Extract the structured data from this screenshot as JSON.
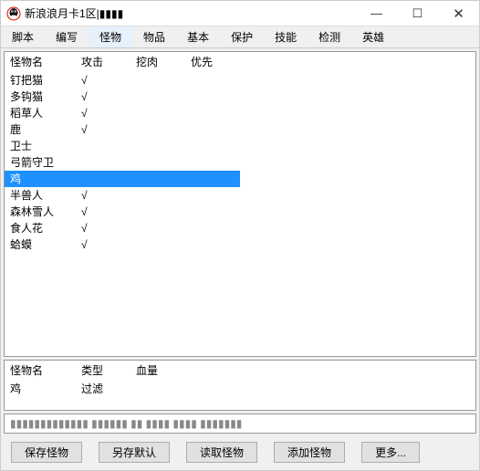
{
  "window": {
    "title": "新浪浪月卡1区|▮▮▮▮"
  },
  "menubar": [
    "脚本",
    "编写",
    "怪物",
    "物品",
    "基本",
    "保护",
    "技能",
    "检测",
    "英雄"
  ],
  "active_menu_index": 2,
  "table": {
    "headers": [
      "怪物名",
      "攻击",
      "挖肉",
      "优先"
    ],
    "rows": [
      {
        "name": "钉把猫",
        "attack": "√",
        "dig": "",
        "prio": ""
      },
      {
        "name": "多钩猫",
        "attack": "√",
        "dig": "",
        "prio": ""
      },
      {
        "name": "稻草人",
        "attack": "√",
        "dig": "",
        "prio": ""
      },
      {
        "name": "鹿",
        "attack": "√",
        "dig": "",
        "prio": ""
      },
      {
        "name": "卫士",
        "attack": "",
        "dig": "",
        "prio": ""
      },
      {
        "name": "弓箭守卫",
        "attack": "",
        "dig": "",
        "prio": ""
      },
      {
        "name": "鸡",
        "attack": "",
        "dig": "",
        "prio": ""
      },
      {
        "name": "半兽人",
        "attack": "√",
        "dig": "",
        "prio": ""
      },
      {
        "name": "森林雪人",
        "attack": "√",
        "dig": "",
        "prio": ""
      },
      {
        "name": "食人花",
        "attack": "√",
        "dig": "",
        "prio": ""
      },
      {
        "name": "蛤蟆",
        "attack": "√",
        "dig": "",
        "prio": ""
      }
    ],
    "selected_index": 6
  },
  "detail": {
    "headers": [
      "怪物名",
      "类型",
      "血量"
    ],
    "rows": [
      {
        "name": "鸡",
        "type": "过滤",
        "hp": ""
      }
    ]
  },
  "status": "▮▮▮▮▮▮▮▮▮▮▮▮▮   ▮▮▮▮▮▮   ▮▮  ▮▮▮▮   ▮▮▮▮ ▮▮▮▮▮▮▮",
  "buttons": [
    "保存怪物",
    "另存默认",
    "读取怪物",
    "添加怪物",
    "更多..."
  ]
}
